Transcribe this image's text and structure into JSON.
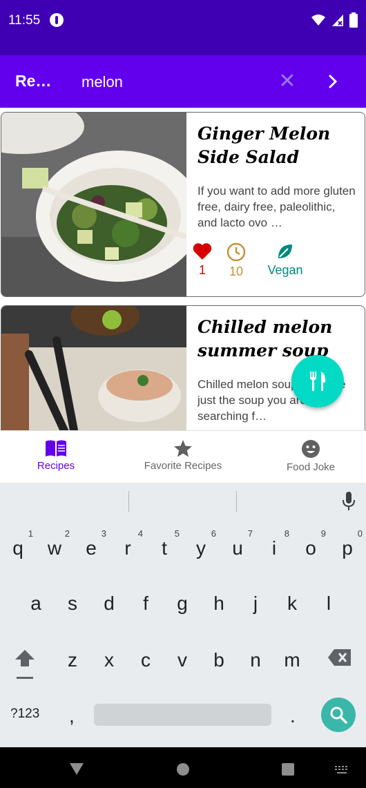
{
  "status": {
    "time": "11:55"
  },
  "app_bar": {
    "title": "Re…",
    "search_value": "melon",
    "clear_icon": "close-icon",
    "go_icon": "chevron-right-icon"
  },
  "recipes": [
    {
      "title": "Ginger Melon Side Salad",
      "description": "If you want to add more gluten free, dairy free, paleolithic, and lacto ovo …",
      "likes": "1",
      "minutes": "10",
      "diet": "Vegan"
    },
    {
      "title": "Chilled melon summer soup",
      "description": "Chilled melon soup might be just the soup you are searching f…"
    }
  ],
  "fab": {
    "icon": "restaurant-icon"
  },
  "bottom_nav": [
    {
      "label": "Recipes",
      "icon": "book-icon",
      "active": true
    },
    {
      "label": "Favorite Recipes",
      "icon": "star-icon",
      "active": false
    },
    {
      "label": "Food Joke",
      "icon": "smile-icon",
      "active": false
    }
  ],
  "keyboard": {
    "row1": [
      {
        "key": "q",
        "hint": "1"
      },
      {
        "key": "w",
        "hint": "2"
      },
      {
        "key": "e",
        "hint": "3"
      },
      {
        "key": "r",
        "hint": "4"
      },
      {
        "key": "t",
        "hint": "5"
      },
      {
        "key": "y",
        "hint": "6"
      },
      {
        "key": "u",
        "hint": "7"
      },
      {
        "key": "i",
        "hint": "8"
      },
      {
        "key": "o",
        "hint": "9"
      },
      {
        "key": "p",
        "hint": "0"
      }
    ],
    "row2": [
      "a",
      "s",
      "d",
      "f",
      "g",
      "h",
      "j",
      "k",
      "l"
    ],
    "row3": [
      "z",
      "x",
      "c",
      "v",
      "b",
      "n",
      "m"
    ],
    "symbols_label": "?123",
    "comma": ",",
    "period": "."
  },
  "colors": {
    "status_bar": "#3f00b4",
    "app_bar": "#6200ee",
    "accent": "#03dac5",
    "like": "#d50000",
    "time": "#c8913a",
    "vegan": "#00897b",
    "nav_active": "#6200ee",
    "nav_inactive": "#666666"
  }
}
